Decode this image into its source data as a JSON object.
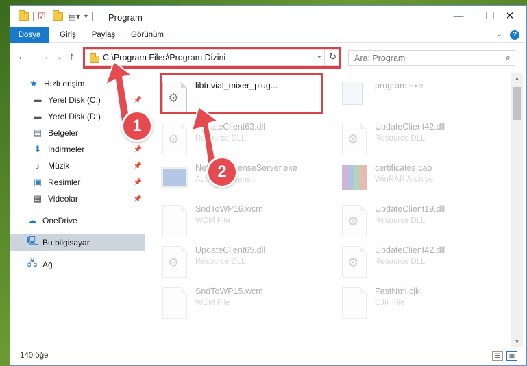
{
  "window": {
    "title": "Program",
    "controls": {
      "minimize": "—",
      "maximize": "☐",
      "close": "✕"
    }
  },
  "ribbon": {
    "tabs": [
      "Dosya",
      "Giriş",
      "Paylaş",
      "Görünüm"
    ]
  },
  "address": {
    "path": "C:\\Program Files\\Program Dizini",
    "search_placeholder": "Ara: Program"
  },
  "sidebar": {
    "items": [
      {
        "label": "Hızlı erişim",
        "icon": "star-icon",
        "pinned": false
      },
      {
        "label": "Yerel Disk (C:)",
        "icon": "drive-icon",
        "pinned": true
      },
      {
        "label": "Yerel Disk (D:)",
        "icon": "drive-icon",
        "pinned": false
      },
      {
        "label": "Belgeler",
        "icon": "documents-icon",
        "pinned": false
      },
      {
        "label": "İndirmeler",
        "icon": "download-icon",
        "pinned": true
      },
      {
        "label": "Müzik",
        "icon": "music-icon",
        "pinned": true
      },
      {
        "label": "Resimler",
        "icon": "pictures-icon",
        "pinned": true
      },
      {
        "label": "Videolar",
        "icon": "videos-icon",
        "pinned": true
      },
      {
        "label": "OneDrive",
        "icon": "cloud-icon",
        "pinned": false
      },
      {
        "label": "Bu bilgisayar",
        "icon": "computer-icon",
        "pinned": false,
        "selected": true
      },
      {
        "label": "Ağ",
        "icon": "network-icon",
        "pinned": false
      }
    ]
  },
  "files": [
    {
      "name": "libtrivial_mixer_plug...",
      "type": "",
      "kind": "dll",
      "highlighted": true
    },
    {
      "name": "program.exe",
      "type": "",
      "kind": "app"
    },
    {
      "name": "UpdateClient63.dll",
      "type": "Resource DLL",
      "kind": "dll"
    },
    {
      "name": "UpdateClient42.dll",
      "type": "Resource DLL",
      "kind": "dll"
    },
    {
      "name": "NetworkLicenseServer.exe",
      "type": "Autodesk licens...",
      "kind": "exe"
    },
    {
      "name": "certificates.cab",
      "type": "WinRAR Archive",
      "kind": "rar"
    },
    {
      "name": "SndToWP16.wcm",
      "type": "WCM File",
      "kind": "doc"
    },
    {
      "name": "UpdateClient19.dll",
      "type": "Resource DLL",
      "kind": "dll"
    },
    {
      "name": "UpdateClient65.dll",
      "type": "Resource DLL",
      "kind": "dll"
    },
    {
      "name": "UpdateClient42.dll",
      "type": "Resource DLL",
      "kind": "dll"
    },
    {
      "name": "SndToWP15.wcm",
      "type": "WCM File",
      "kind": "doc"
    },
    {
      "name": "FastNml.cjk",
      "type": "CJK File",
      "kind": "doc"
    }
  ],
  "status": {
    "count": "140 öğe"
  },
  "annotations": {
    "step1": "1",
    "step2": "2",
    "color": "#d8434a"
  }
}
